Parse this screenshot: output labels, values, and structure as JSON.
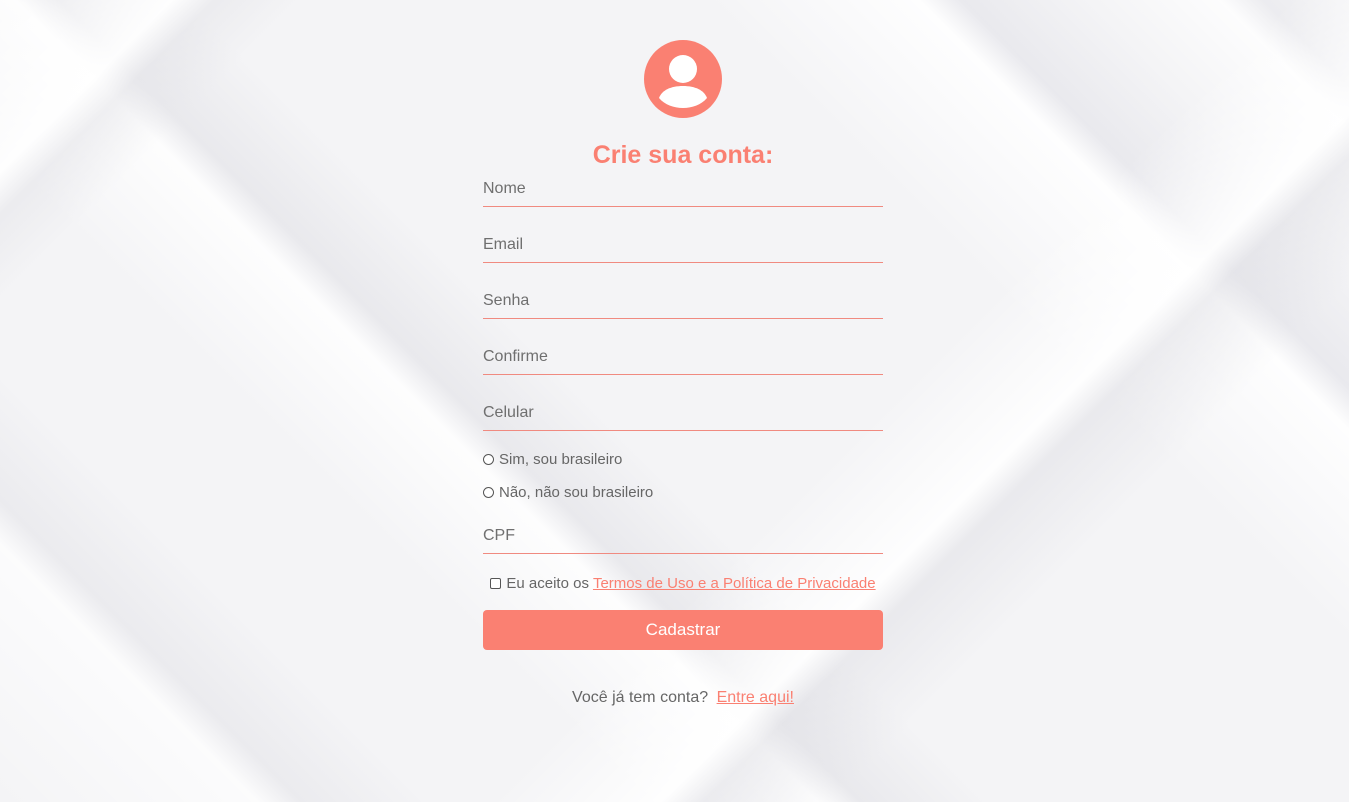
{
  "brand": {
    "accent": "#fa8072"
  },
  "header": {
    "avatar_icon": "user-circle-icon",
    "title": "Crie sua conta:"
  },
  "form": {
    "fields": {
      "name": {
        "placeholder": "Nome",
        "value": ""
      },
      "email": {
        "placeholder": "Email",
        "value": ""
      },
      "password": {
        "placeholder": "Senha",
        "value": ""
      },
      "confirm": {
        "placeholder": "Confirme",
        "value": ""
      },
      "phone": {
        "placeholder": "Celular",
        "value": ""
      },
      "cpf": {
        "placeholder": "CPF",
        "value": ""
      }
    },
    "nationality": {
      "yes_label": "Sim, sou brasileiro",
      "no_label": "Não, não sou brasileiro",
      "selected": null
    },
    "terms": {
      "prefix": "Eu aceito os",
      "link_text": "Termos de Uso e a Política de Privacidade",
      "checked": false
    },
    "submit_label": "Cadastrar"
  },
  "footer": {
    "question": "Você já tem conta?",
    "link_text": "Entre aqui!"
  }
}
